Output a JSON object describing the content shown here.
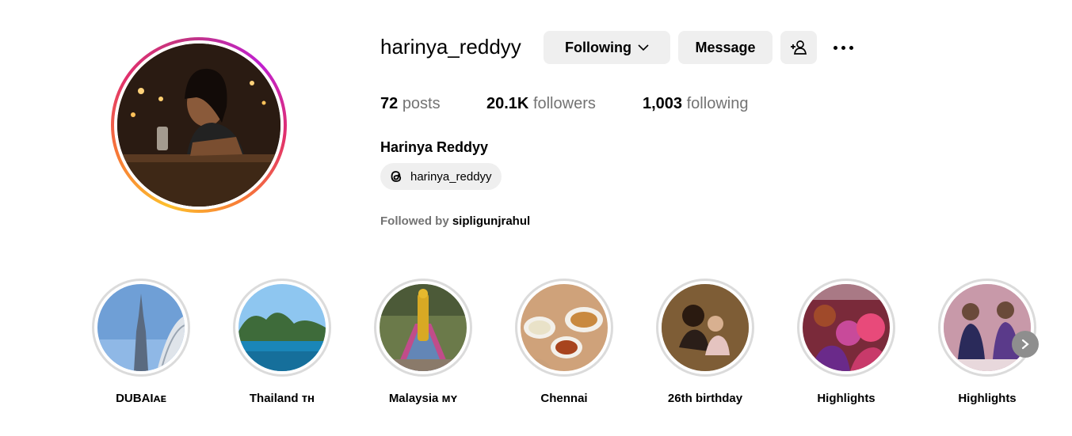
{
  "profile": {
    "username": "harinya_reddyy",
    "full_name": "Harinya Reddyy",
    "threads_handle": "harinya_reddyy",
    "followed_by_prefix": "Followed by ",
    "followed_by_user": "sipligunjrahul"
  },
  "actions": {
    "following_label": "Following",
    "message_label": "Message"
  },
  "stats": {
    "posts_count": "72",
    "posts_label": "posts",
    "followers_count": "20.1K",
    "followers_label": "followers",
    "following_count": "1,003",
    "following_label": "following"
  },
  "highlights": [
    {
      "label": "DUBAIᴀᴇ"
    },
    {
      "label": "Thailand ᴛʜ"
    },
    {
      "label": "Malaysia ᴍʏ"
    },
    {
      "label": "Chennai"
    },
    {
      "label": "26th birthday"
    },
    {
      "label": "Highlights"
    },
    {
      "label": "Highlights"
    }
  ],
  "colors": {
    "button_bg": "#efefef",
    "muted_text": "#737373",
    "ring_border": "#dbdbdb"
  }
}
